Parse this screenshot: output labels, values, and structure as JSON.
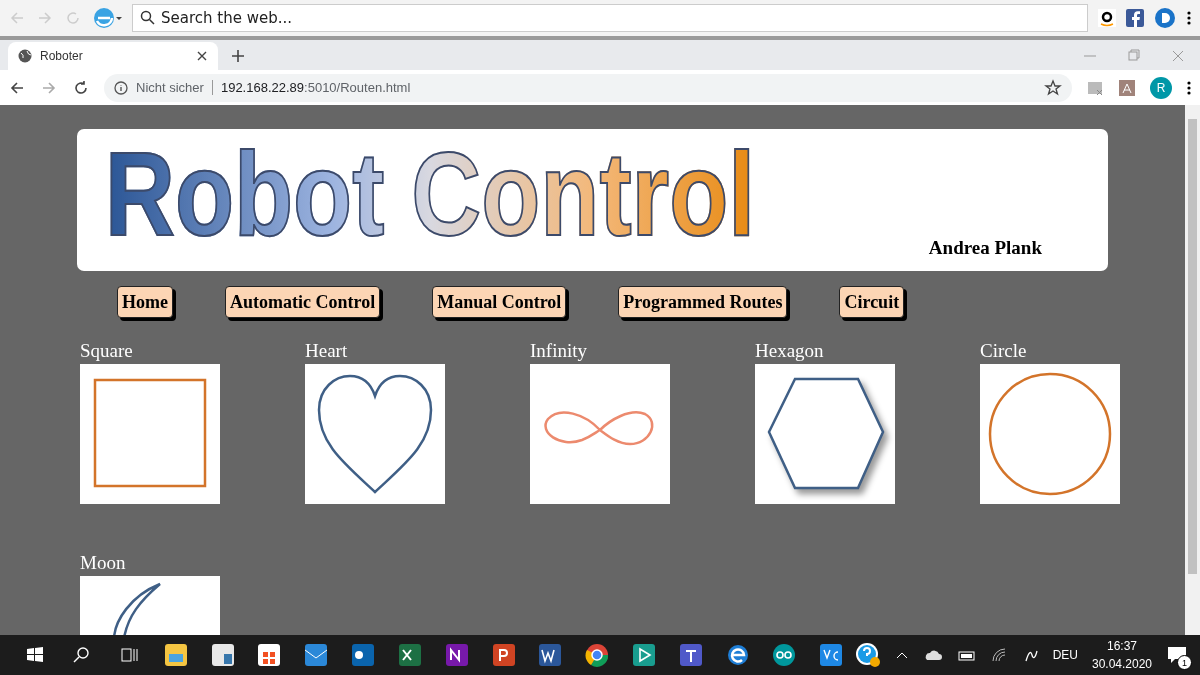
{
  "browser_bar": {
    "search_placeholder": "Search the web..."
  },
  "tab": {
    "title": "Roboter"
  },
  "address": {
    "security": "Nicht sicher",
    "host": "192.168.22.89",
    "path": ":5010/Routen.html"
  },
  "profile": "R",
  "page": {
    "logo": "Robot Control",
    "author": "Andrea Plank",
    "nav": [
      {
        "label": "Home"
      },
      {
        "label": "Automatic Control"
      },
      {
        "label": "Manual Control"
      },
      {
        "label": "Programmed Routes"
      },
      {
        "label": "Circuit"
      }
    ],
    "routes": [
      {
        "name": "Square",
        "kind": "square"
      },
      {
        "name": "Heart",
        "kind": "heart"
      },
      {
        "name": "Infinity",
        "kind": "infinity"
      },
      {
        "name": "Hexagon",
        "kind": "hexagon"
      },
      {
        "name": "Circle",
        "kind": "circle"
      },
      {
        "name": "Moon",
        "kind": "moon"
      }
    ]
  },
  "taskbar": {
    "language": "DEU",
    "time": "16:37",
    "date": "30.04.2020",
    "notifications": "1"
  }
}
